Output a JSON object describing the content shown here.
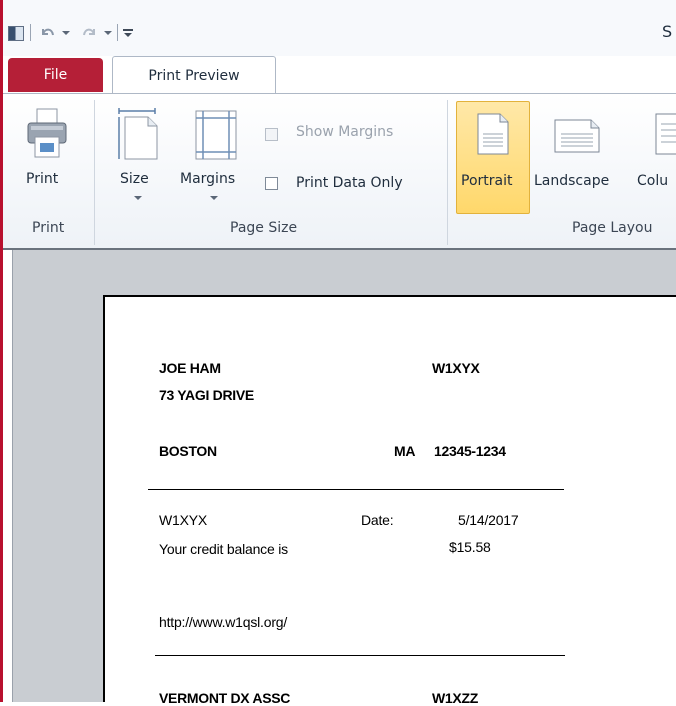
{
  "titlebar": {
    "title_fragment": "S",
    "icons": [
      "app-icon",
      "undo-icon",
      "redo-icon",
      "customize-qat-icon"
    ]
  },
  "tabs": {
    "file": "File",
    "print_preview": "Print Preview"
  },
  "ribbon": {
    "print_group": {
      "print_button": "Print",
      "label": "Print"
    },
    "page_size_group": {
      "size_button": "Size",
      "margins_button": "Margins",
      "show_margins": {
        "label": "Show Margins",
        "checked": false,
        "enabled": false
      },
      "print_data_only": {
        "label": "Print Data Only",
        "checked": false,
        "enabled": true
      },
      "label": "Page Size"
    },
    "page_layout_group": {
      "portrait_button": "Portrait",
      "landscape_button": "Landscape",
      "columns_button": "Colu",
      "label": "Page Layou"
    }
  },
  "report": {
    "name": "JOE HAM",
    "callsign": "W1XYX",
    "address": "73 YAGI DRIVE",
    "city": "BOSTON",
    "state": "MA",
    "zip": "12345-1234",
    "detail_callsign": "W1XYX",
    "date_label": "Date:",
    "date_value": "5/14/2017",
    "balance_label": "Your credit balance is",
    "balance_value": "$15.58",
    "url": "http://www.w1qsl.org/",
    "next_name": "VERMONT DX ASSC",
    "next_callsign": "W1XZZ"
  },
  "colors": {
    "file_tab": "#b51f37",
    "portrait_highlight": "#ffd86b",
    "preview_bg": "#c9cdd2"
  }
}
